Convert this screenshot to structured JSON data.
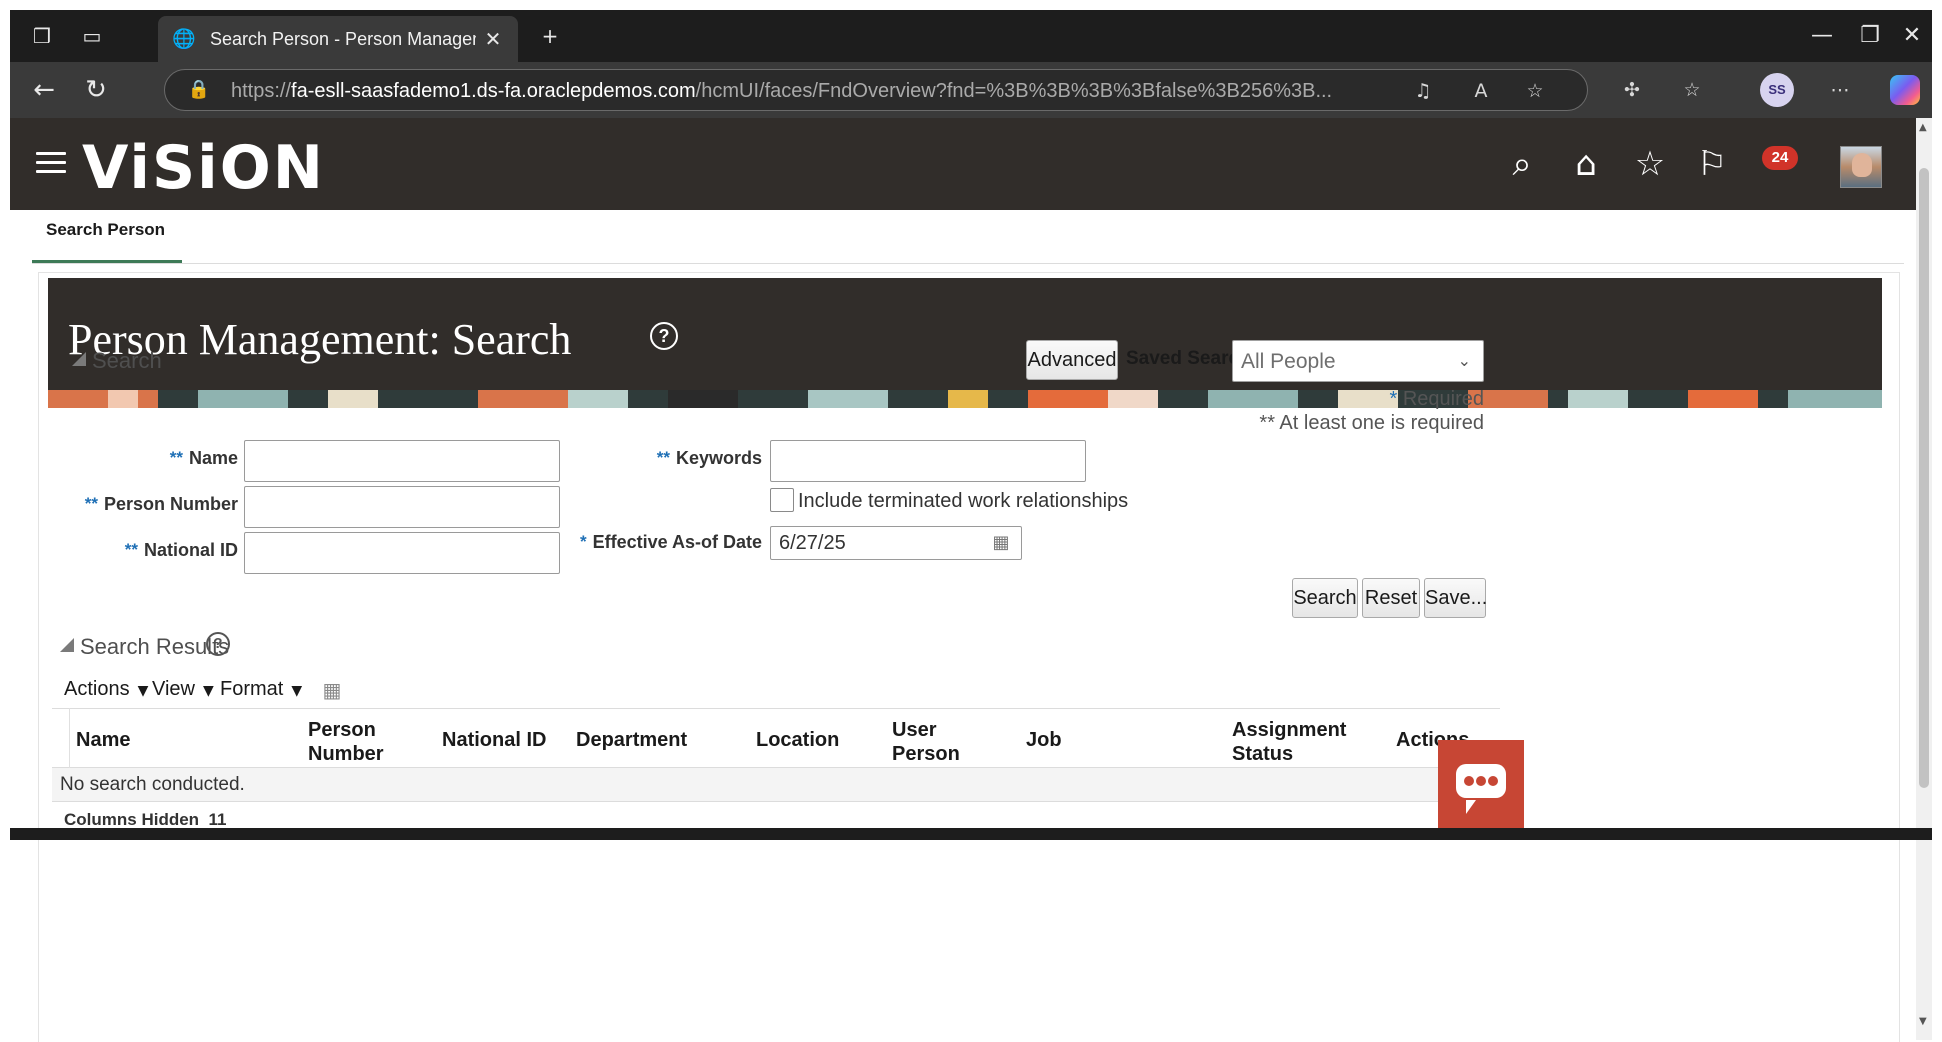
{
  "browser": {
    "tab_title": "Search Person - Person Managem",
    "url_prefix": "https://",
    "url_host": "fa-esll-saasfademo1.ds-fa.oraclepdemos.com",
    "url_path": "/hcmUI/faces/FndOverview?fnd=%3B%3B%3B%3Bfalse%3B256%3B...",
    "profile_initials": "SS"
  },
  "app": {
    "brand": "ViSiON",
    "notification_count": "24"
  },
  "page": {
    "tab_label": "Search Person",
    "title": "Person Management: Search",
    "help_glyph": "?"
  },
  "search": {
    "section_title": "Search",
    "advanced_button": "Advanced",
    "saved_search_label": "Saved Search",
    "saved_search_value": "All People",
    "required_note": "Required",
    "at_least_one_note": "** At least one is required",
    "name_label": "Name",
    "person_number_label": "Person Number",
    "national_id_label": "National ID",
    "keywords_label": "Keywords",
    "include_terminated_label": "Include terminated work relationships",
    "effective_date_label": "Effective As-of Date",
    "effective_date_value": "6/27/25",
    "search_button": "Search",
    "reset_button": "Reset",
    "save_button": "Save..."
  },
  "results": {
    "section_title": "Search Results",
    "toolbar": {
      "actions": "Actions",
      "view": "View",
      "format": "Format"
    },
    "columns": [
      "Name",
      "Person Number",
      "National ID",
      "Department",
      "Location",
      "User Person Type",
      "Job",
      "Assignment Status",
      "Actions"
    ],
    "empty_message": "No search conducted.",
    "columns_hidden_label": "Columns Hidden",
    "columns_hidden_count": "11"
  },
  "colors": {
    "header_bg": "#312d2a",
    "accent_green": "#3d7a57",
    "required_blue": "#1e6fb5",
    "chat_red": "#c74634",
    "badge_red": "#d13329"
  },
  "icons": [
    "workspaces-icon",
    "tab-actions-icon",
    "globe-icon",
    "close-icon",
    "new-tab-icon",
    "minimize-icon",
    "restore-icon",
    "window-close-icon",
    "back-icon",
    "refresh-icon",
    "lock-icon",
    "notification-bell-icon",
    "read-aloud-icon",
    "favorite-star-icon",
    "extensions-icon",
    "favorites-icon",
    "more-icon",
    "copilot-icon",
    "menu-icon",
    "search-icon",
    "home-icon",
    "star-icon",
    "flag-icon",
    "calendar-icon",
    "help-icon",
    "freeze-icon",
    "chat-icon"
  ]
}
